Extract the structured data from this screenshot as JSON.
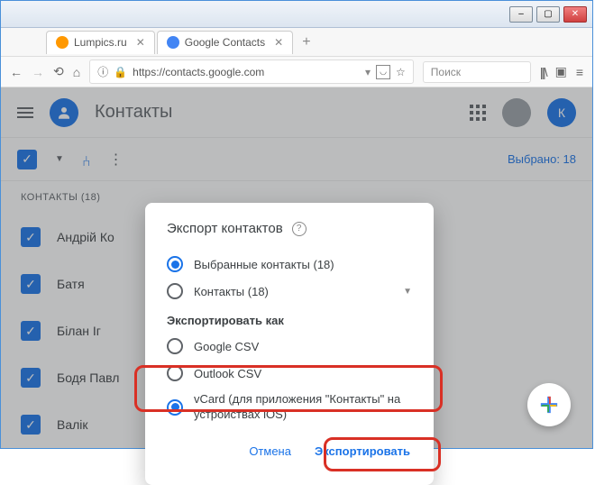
{
  "window": {
    "minimize": "–",
    "maximize": "▢",
    "close": "✕"
  },
  "tabs": [
    {
      "title": "Lumpics.ru"
    },
    {
      "title": "Google Contacts"
    }
  ],
  "address": {
    "url": "https://contacts.google.com",
    "search_placeholder": "Поиск"
  },
  "header": {
    "app_title": "Контакты",
    "user_initial": "К"
  },
  "toolbar": {
    "selected_text": "Выбрано: 18"
  },
  "sidebar": {
    "section": "КОНТАКТЫ (18)"
  },
  "contacts": [
    "Андрій Ко",
    "Батя",
    "Білан Іг",
    "Бодя Павл",
    "Валік"
  ],
  "modal": {
    "title": "Экспорт контактов",
    "scope": {
      "selected": "Выбранные контакты (18)",
      "all": "Контакты (18)"
    },
    "format_label": "Экспортировать как",
    "formats": {
      "gcsv": "Google CSV",
      "ocsv": "Outlook CSV",
      "vcard": "vCard (для приложения \"Контакты\" на устройствах iOS)"
    },
    "cancel": "Отмена",
    "export": "Экспортировать"
  }
}
